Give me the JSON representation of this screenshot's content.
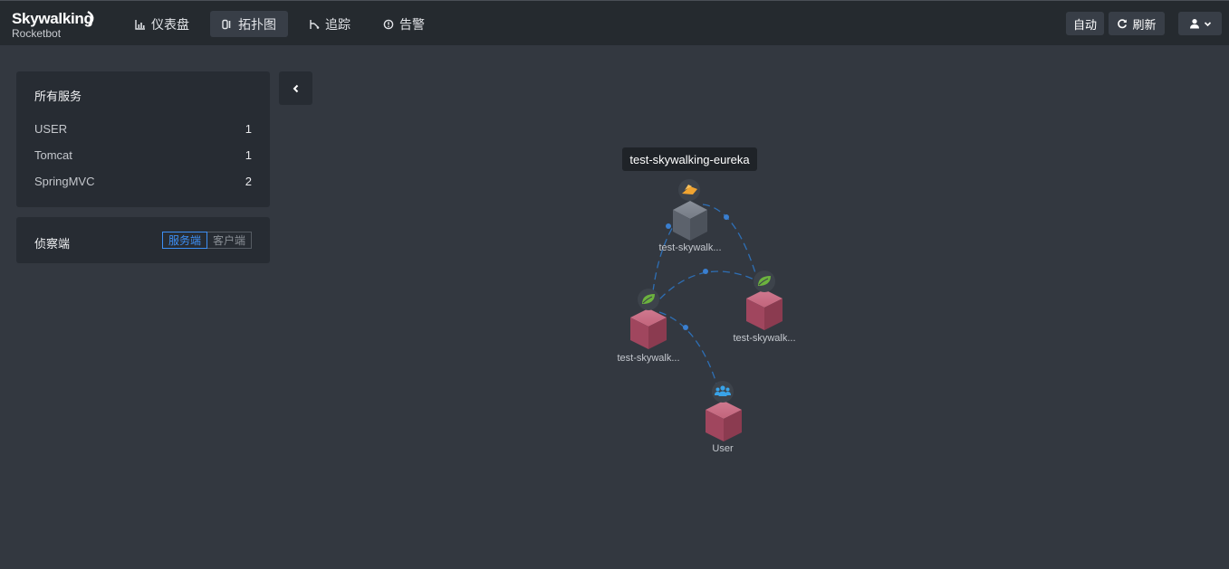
{
  "header": {
    "logo_main": "Skywalking",
    "logo_sub": "Rocketbot",
    "nav": [
      {
        "label": "仪表盘",
        "icon": "chart-bar-icon"
      },
      {
        "label": "拓扑图",
        "icon": "topology-icon",
        "active": true
      },
      {
        "label": "追踪",
        "icon": "trace-icon"
      },
      {
        "label": "告警",
        "icon": "alarm-icon"
      }
    ],
    "auto_label": "自动",
    "refresh_label": "刷新",
    "user_icon": "user-icon"
  },
  "services_panel": {
    "title": "所有服务",
    "items": [
      {
        "name": "USER",
        "count": "1"
      },
      {
        "name": "Tomcat",
        "count": "1"
      },
      {
        "name": "SpringMVC",
        "count": "2"
      }
    ]
  },
  "detect_panel": {
    "title": "侦察端",
    "options": [
      "服务端",
      "客户端"
    ],
    "selected": "服务端"
  },
  "topology": {
    "tooltip": "test-skywalking-eureka",
    "nodes": [
      {
        "id": "eureka",
        "label": "test-skywalk...",
        "icon": "eureka-icon",
        "color": "#5a606a"
      },
      {
        "id": "svc-a",
        "label": "test-skywalk...",
        "icon": "spring-leaf-icon",
        "color": "#b04c66"
      },
      {
        "id": "svc-b",
        "label": "test-skywalk...",
        "icon": "spring-leaf-icon",
        "color": "#b04c66"
      },
      {
        "id": "user",
        "label": "User",
        "icon": "users-icon",
        "color": "#b04c66"
      }
    ]
  },
  "colors": {
    "accent": "#3d8ff5",
    "link": "#2e6fb5",
    "service_node": "#b04c66",
    "gateway_node": "#5a606a"
  }
}
